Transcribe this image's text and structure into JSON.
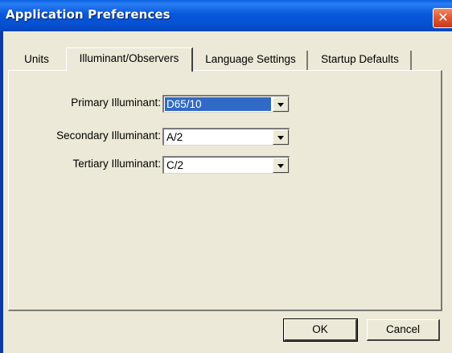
{
  "window": {
    "title": "Application Preferences",
    "close_glyph": "✕"
  },
  "tabs": [
    {
      "label": "Units",
      "selected": false
    },
    {
      "label": "Illuminant/Observers",
      "selected": true
    },
    {
      "label": "Language Settings",
      "selected": false
    },
    {
      "label": "Startup Defaults",
      "selected": false
    }
  ],
  "illuminants": {
    "primary": {
      "label": "Primary Illuminant:",
      "value": "D65/10"
    },
    "secondary": {
      "label": "Secondary Illuminant:",
      "value": "A/2"
    },
    "tertiary": {
      "label": "Tertiary Illuminant:",
      "value": "C/2"
    }
  },
  "buttons": {
    "ok": "OK",
    "cancel": "Cancel"
  },
  "colors": {
    "titlebar": "#0758dc",
    "close": "#e25a34",
    "selection": "#316ac5",
    "face": "#ece9d8"
  },
  "icons": {
    "close": "close-icon",
    "dropdown": "chevron-down-icon"
  }
}
